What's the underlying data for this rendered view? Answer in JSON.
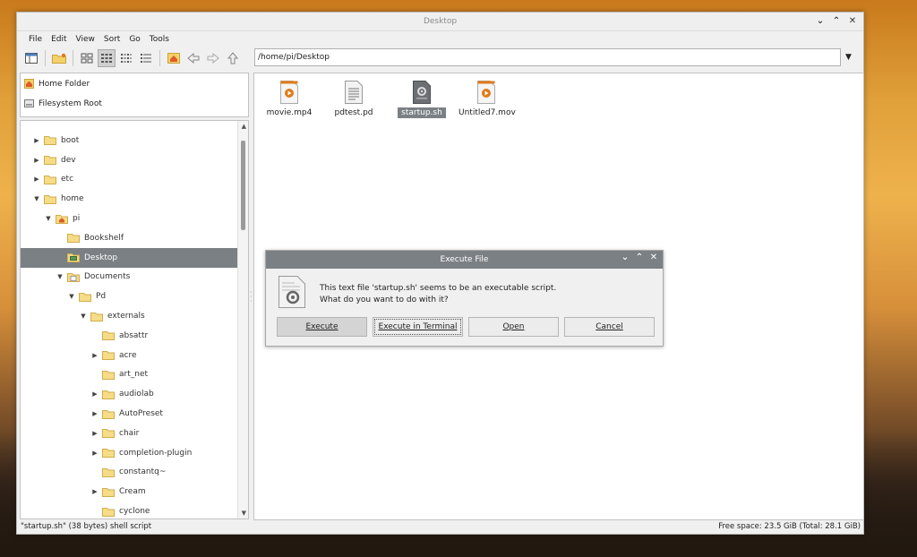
{
  "window": {
    "title": "Desktop"
  },
  "menu": [
    "File",
    "Edit",
    "View",
    "Sort",
    "Go",
    "Tools"
  ],
  "path": {
    "value": "/home/pi/Desktop"
  },
  "places": [
    {
      "label": "Home Folder",
      "icon": "home-icon"
    },
    {
      "label": "Filesystem Root",
      "icon": "drive-icon"
    }
  ],
  "tree": [
    {
      "label": "boot",
      "level": 0,
      "arrow": "right",
      "icon": "folder"
    },
    {
      "label": "dev",
      "level": 0,
      "arrow": "right",
      "icon": "folder"
    },
    {
      "label": "etc",
      "level": 0,
      "arrow": "right",
      "icon": "folder"
    },
    {
      "label": "home",
      "level": 0,
      "arrow": "down",
      "icon": "folder"
    },
    {
      "label": "pi",
      "level": 1,
      "arrow": "down",
      "icon": "home"
    },
    {
      "label": "Bookshelf",
      "level": 2,
      "arrow": "",
      "icon": "folder"
    },
    {
      "label": "Desktop",
      "level": 2,
      "arrow": "",
      "icon": "desktop",
      "selected": true
    },
    {
      "label": "Documents",
      "level": 2,
      "arrow": "down",
      "icon": "documents"
    },
    {
      "label": "Pd",
      "level": 3,
      "arrow": "down",
      "icon": "folder"
    },
    {
      "label": "externals",
      "level": 4,
      "arrow": "down",
      "icon": "folder"
    },
    {
      "label": "absattr",
      "level": 5,
      "arrow": "",
      "icon": "folder"
    },
    {
      "label": "acre",
      "level": 5,
      "arrow": "right",
      "icon": "folder"
    },
    {
      "label": "art_net",
      "level": 5,
      "arrow": "",
      "icon": "folder"
    },
    {
      "label": "audiolab",
      "level": 5,
      "arrow": "right",
      "icon": "folder"
    },
    {
      "label": "AutoPreset",
      "level": 5,
      "arrow": "right",
      "icon": "folder"
    },
    {
      "label": "chair",
      "level": 5,
      "arrow": "right",
      "icon": "folder"
    },
    {
      "label": "completion-plugin",
      "level": 5,
      "arrow": "right",
      "icon": "folder"
    },
    {
      "label": "constantq~",
      "level": 5,
      "arrow": "",
      "icon": "folder"
    },
    {
      "label": "Cream",
      "level": 5,
      "arrow": "right",
      "icon": "folder"
    },
    {
      "label": "cyclone",
      "level": 5,
      "arrow": "",
      "icon": "folder"
    }
  ],
  "files": [
    {
      "name": "movie.mp4",
      "icon": "video-file-icon"
    },
    {
      "name": "pdtest.pd",
      "icon": "text-file-icon"
    },
    {
      "name": "startup.sh",
      "icon": "script-file-icon",
      "selected": true
    },
    {
      "name": "Untitled7.mov",
      "icon": "video-file-icon"
    }
  ],
  "dialog": {
    "title": "Execute File",
    "message_line1": "This text file 'startup.sh' seems to be an executable script.",
    "message_line2": "What do you want to do with it?",
    "buttons": [
      "Execute",
      "Execute in Terminal",
      "Open",
      "Cancel"
    ]
  },
  "status": {
    "left": "\"startup.sh\" (38 bytes) shell script",
    "right": "Free space: 23.5 GiB (Total: 28.1 GiB)"
  },
  "colors": {
    "selection": "#7b8084",
    "folder": "#f4d26b",
    "accent_orange": "#e07b1a"
  }
}
